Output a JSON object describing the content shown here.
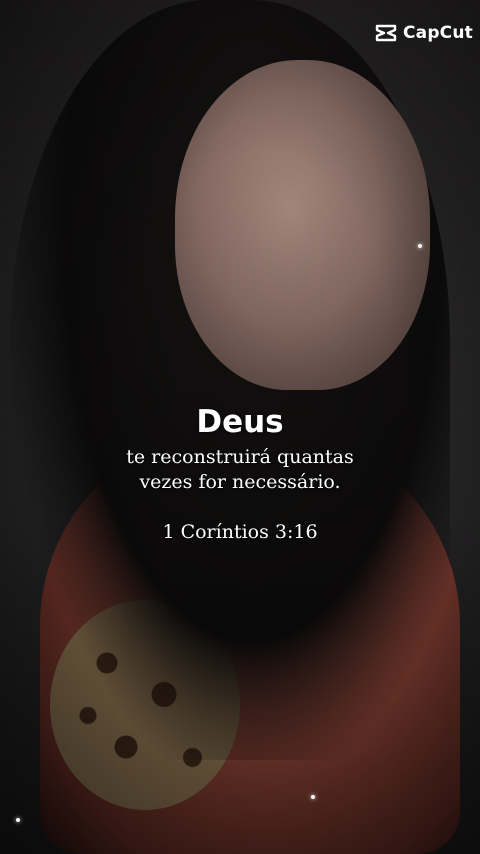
{
  "watermark": {
    "text": "CapCut",
    "icon": "capcut-logo-icon"
  },
  "verse": {
    "title": "Deus",
    "line1": "te reconstruirá quantas",
    "line2": "vezes for necessário.",
    "reference": "1 Coríntios 3:16"
  }
}
